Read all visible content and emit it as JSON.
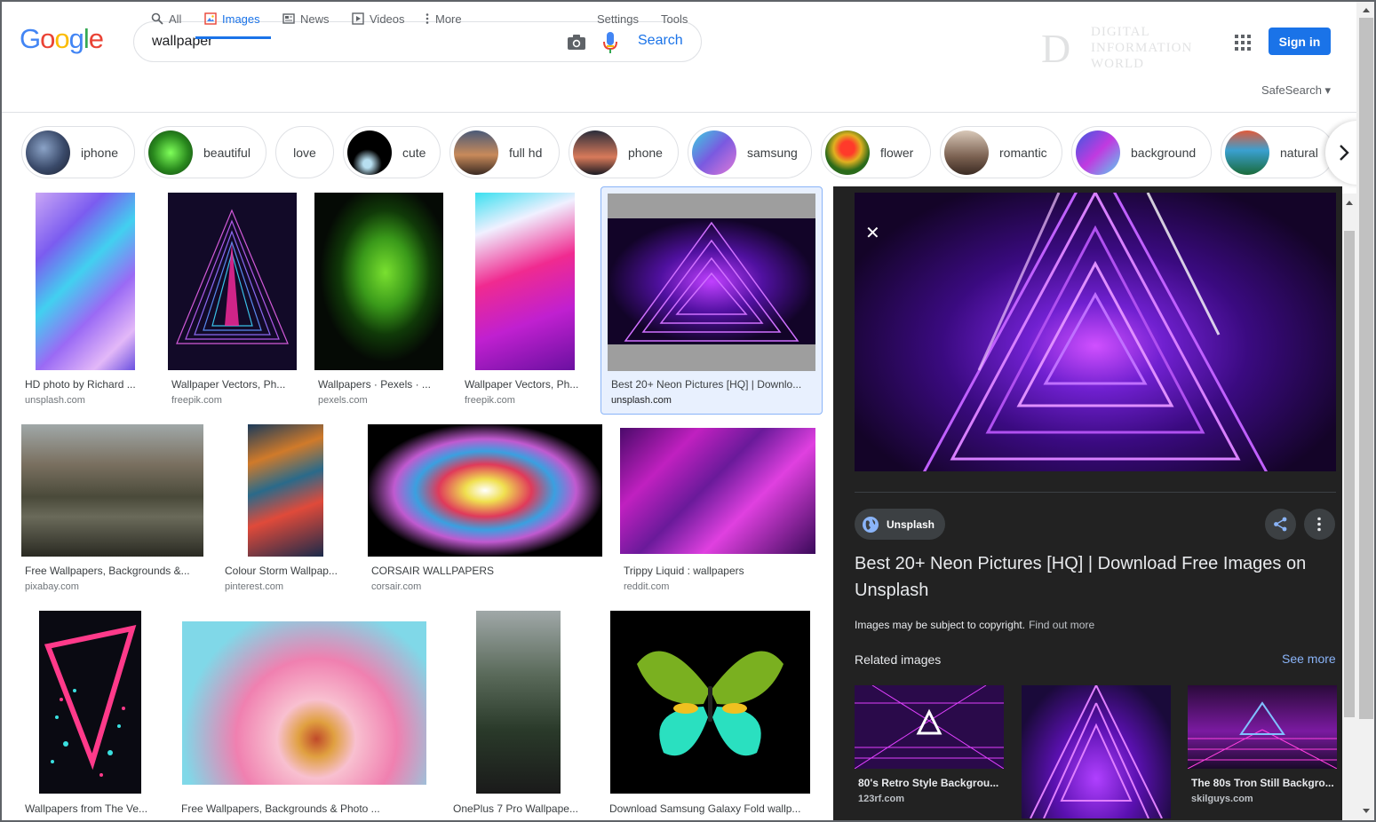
{
  "search": {
    "query": "wallpaper",
    "button_label": "Search"
  },
  "header": {
    "signin_label": "Sign in",
    "safesearch_label": "SafeSearch ▾",
    "watermark": {
      "letter": "D",
      "line1": "DIGITAL",
      "line2": "INFORMATION",
      "line3": "WORLD"
    }
  },
  "nav": {
    "all": "All",
    "images": "Images",
    "news": "News",
    "videos": "Videos",
    "more": "More",
    "settings": "Settings",
    "tools": "Tools"
  },
  "chips": [
    {
      "label": "iphone"
    },
    {
      "label": "beautiful"
    },
    {
      "label": "love"
    },
    {
      "label": "cute"
    },
    {
      "label": "full hd"
    },
    {
      "label": "phone"
    },
    {
      "label": "samsung"
    },
    {
      "label": "flower"
    },
    {
      "label": "romantic"
    },
    {
      "label": "background"
    },
    {
      "label": "natural"
    }
  ],
  "results": [
    {
      "title": "HD photo by Richard ...",
      "source": "unsplash.com"
    },
    {
      "title": "Wallpaper Vectors, Ph...",
      "source": "freepik.com"
    },
    {
      "title": "Wallpapers · Pexels · ...",
      "source": "pexels.com"
    },
    {
      "title": "Wallpaper Vectors, Ph...",
      "source": "freepik.com"
    },
    {
      "title": "Best 20+ Neon Pictures [HQ] | Downlo...",
      "source": "unsplash.com"
    },
    {
      "title": "Free Wallpapers, Backgrounds &...",
      "source": "pixabay.com"
    },
    {
      "title": "Colour Storm Wallpap...",
      "source": "pinterest.com"
    },
    {
      "title": "CORSAIR WALLPAPERS",
      "source": "corsair.com"
    },
    {
      "title": "Trippy Liquid : wallpapers",
      "source": "reddit.com"
    },
    {
      "title": "Wallpapers from The Ve...",
      "source": ""
    },
    {
      "title": "Free Wallpapers, Backgrounds & Photo ...",
      "source": ""
    },
    {
      "title": "OnePlus 7 Pro Wallpape...",
      "source": ""
    },
    {
      "title": "Download Samsung Galaxy Fold wallp...",
      "source": ""
    }
  ],
  "panel": {
    "close": "✕",
    "source": "Unsplash",
    "title": "Best 20+ Neon Pictures [HQ] | Download Free Images on Unsplash",
    "copyright": "Images may be subject to copyright.",
    "find_out_more": "Find out more",
    "related_label": "Related images",
    "see_more": "See more",
    "related": [
      {
        "title": "80's Retro Style Backgrou...",
        "source": "123rf.com"
      },
      {
        "title": "",
        "source": ""
      },
      {
        "title": "The 80s Tron Still Backgro...",
        "source": "skilguys.com"
      }
    ]
  }
}
